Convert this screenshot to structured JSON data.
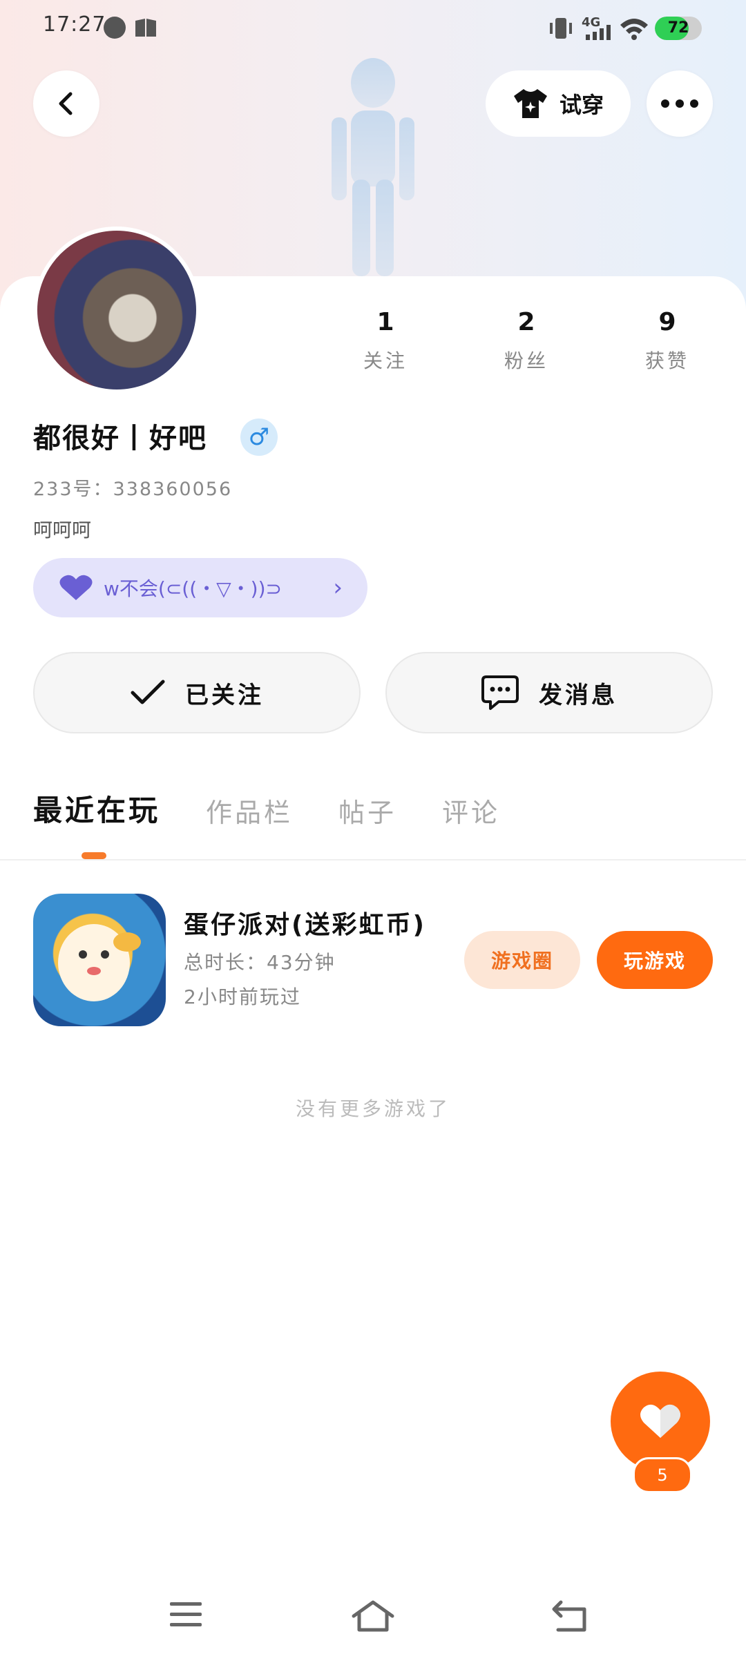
{
  "status_bar": {
    "time": "17:27",
    "network": "4G",
    "battery_percent": "72",
    "battery_level": 0.72
  },
  "header": {
    "back_icon": "chevron-left-icon",
    "try_on_label": "试穿",
    "more_icon": "more-dots-icon"
  },
  "profile": {
    "stats": [
      {
        "value": "1",
        "label": "关注"
      },
      {
        "value": "2",
        "label": "粉丝"
      },
      {
        "value": "9",
        "label": "获赞"
      }
    ],
    "name": "都很好丨好吧",
    "gender_symbol": "♂",
    "uid": "233号：338360056",
    "bio": "呵呵呵",
    "club_label": "w不会(⊂((・▽・))⊃",
    "club_chevron": "›"
  },
  "actions": {
    "followed_label": "已关注",
    "message_label": "发消息"
  },
  "tabs": [
    {
      "label": "最近在玩",
      "active": true
    },
    {
      "label": "作品栏",
      "active": false
    },
    {
      "label": "帖子",
      "active": false
    },
    {
      "label": "评论",
      "active": false
    }
  ],
  "games": [
    {
      "title": "蛋仔派对(送彩虹币)",
      "duration": "总时长：43分钟",
      "last_played": "2小时前玩过",
      "circle_label": "游戏圈",
      "play_label": "玩游戏"
    }
  ],
  "no_more_text": "没有更多游戏了",
  "like": {
    "count": "5"
  },
  "colors": {
    "accent": "#ff6a10",
    "club_bg": "#e4e3fb",
    "club_text": "#6a5fd4",
    "gender_bg": "#d6ebfb",
    "gender_fg": "#2b8ae0"
  }
}
